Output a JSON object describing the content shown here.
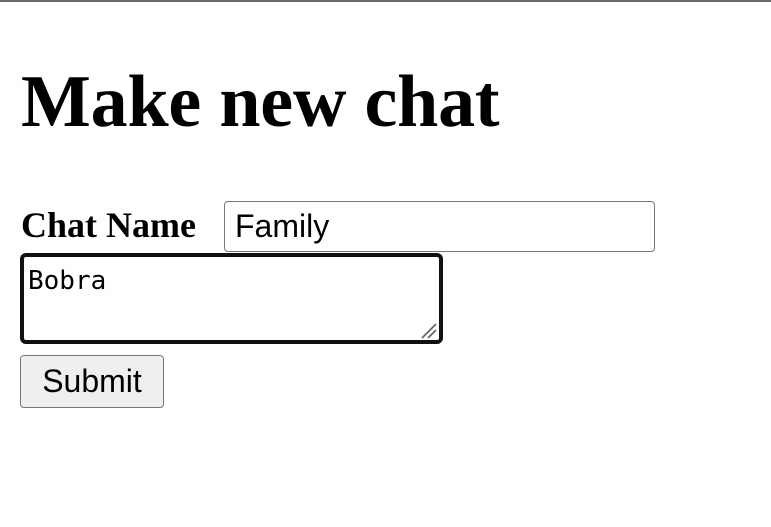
{
  "page": {
    "title": "Make new chat"
  },
  "form": {
    "chat_name_label": "Chat Name",
    "chat_name_value": "Family",
    "message_value": "Bobra",
    "submit_label": "Submit"
  },
  "icons": {
    "resize_grip": "resize-grip-icon"
  }
}
